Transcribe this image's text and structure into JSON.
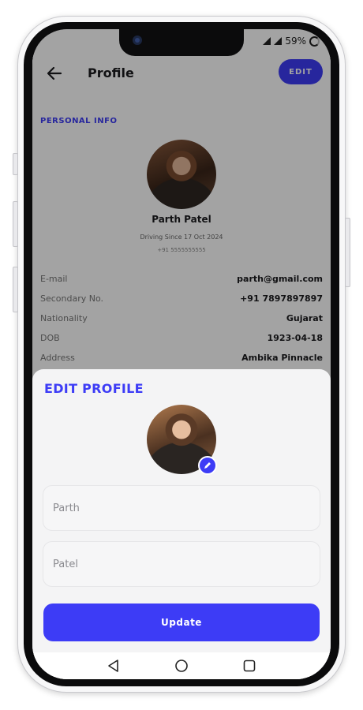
{
  "status_bar": {
    "battery": "59%"
  },
  "header": {
    "title": "Profile",
    "edit_label": "EDIT"
  },
  "profile": {
    "section_label": "PERSONAL INFO",
    "name": "Parth Patel",
    "driving_since": "Driving Since 17 Oct 2024",
    "phone": "+91 5555555555",
    "info": [
      {
        "key": "E-mail",
        "value": "parth@gmail.com"
      },
      {
        "key": "Secondary No.",
        "value": "+91 7897897897"
      },
      {
        "key": "Nationality",
        "value": "Gujarat"
      },
      {
        "key": "DOB",
        "value": "1923-04-18"
      },
      {
        "key": "Address",
        "value": "Ambika Pinnacle"
      }
    ]
  },
  "edit_sheet": {
    "title": "EDIT PROFILE",
    "first_name_placeholder": "Parth",
    "last_name_placeholder": "Patel",
    "update_label": "Update"
  },
  "icons": {
    "back": "arrow-left-icon",
    "edit_avatar": "pencil-icon",
    "nav_back": "triangle-back-icon",
    "nav_home": "circle-home-icon",
    "nav_recents": "square-recents-icon"
  },
  "colors": {
    "accent": "#3d3cf6",
    "sheet_bg": "#f4f4f5"
  }
}
